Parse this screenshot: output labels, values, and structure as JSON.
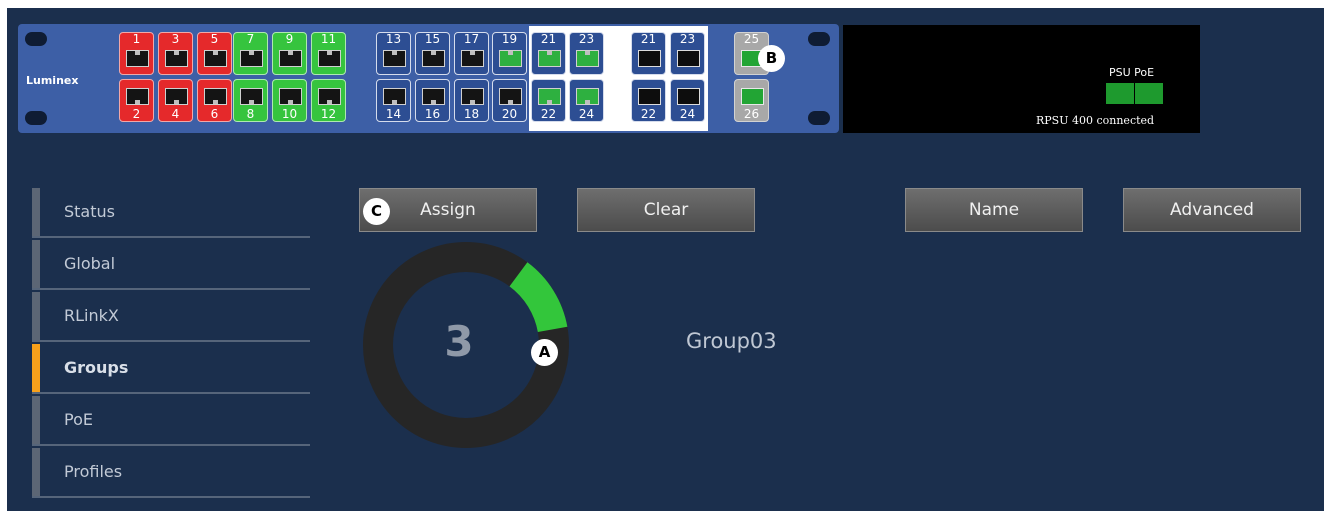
{
  "brand": "Luminex",
  "ports_top": [
    {
      "n": "1",
      "color": "red"
    },
    {
      "n": "3",
      "color": "red"
    },
    {
      "n": "5",
      "color": "red"
    },
    {
      "n": "7",
      "color": "green"
    },
    {
      "n": "9",
      "color": "green"
    },
    {
      "n": "11",
      "color": "green"
    },
    {
      "n": "13",
      "color": "blue"
    },
    {
      "n": "15",
      "color": "blue"
    },
    {
      "n": "17",
      "color": "blue"
    },
    {
      "n": "19",
      "color": "blue-g"
    },
    {
      "n": "21",
      "color": "blue-g"
    },
    {
      "n": "23",
      "color": "blue-g"
    }
  ],
  "ports_bottom": [
    {
      "n": "2",
      "color": "red"
    },
    {
      "n": "4",
      "color": "red"
    },
    {
      "n": "6",
      "color": "red"
    },
    {
      "n": "8",
      "color": "green"
    },
    {
      "n": "10",
      "color": "green"
    },
    {
      "n": "12",
      "color": "green"
    },
    {
      "n": "14",
      "color": "blue"
    },
    {
      "n": "16",
      "color": "blue"
    },
    {
      "n": "18",
      "color": "blue"
    },
    {
      "n": "20",
      "color": "blue"
    },
    {
      "n": "22",
      "color": "blue-g"
    },
    {
      "n": "24",
      "color": "blue-g"
    }
  ],
  "sfp_top": [
    "21",
    "23"
  ],
  "sfp_bottom": [
    "22",
    "24"
  ],
  "uplink_top": "25",
  "uplink_bottom": "26",
  "psu": {
    "label": "PSU PoE",
    "status": "RPSU 400 connected"
  },
  "sidebar": {
    "items": [
      {
        "label": "Status"
      },
      {
        "label": "Global"
      },
      {
        "label": "RLinkX"
      },
      {
        "label": "Groups"
      },
      {
        "label": "PoE"
      },
      {
        "label": "Profiles"
      }
    ],
    "active": "Groups"
  },
  "toolbar": {
    "assign": "Assign",
    "clear": "Clear",
    "name": "Name",
    "advanced": "Advanced"
  },
  "group": {
    "number": "3",
    "name": "Group03",
    "accent": "#33c63b",
    "ring_color": "#262626",
    "highlight_fraction_start": 0.03,
    "highlight_fraction_end": 0.15
  },
  "callouts": {
    "a": "A",
    "b": "B",
    "c": "C"
  },
  "colors": {
    "background": "#1b2f4d",
    "panel": "#3d5fa6",
    "active_accent": "#f7a01b"
  }
}
